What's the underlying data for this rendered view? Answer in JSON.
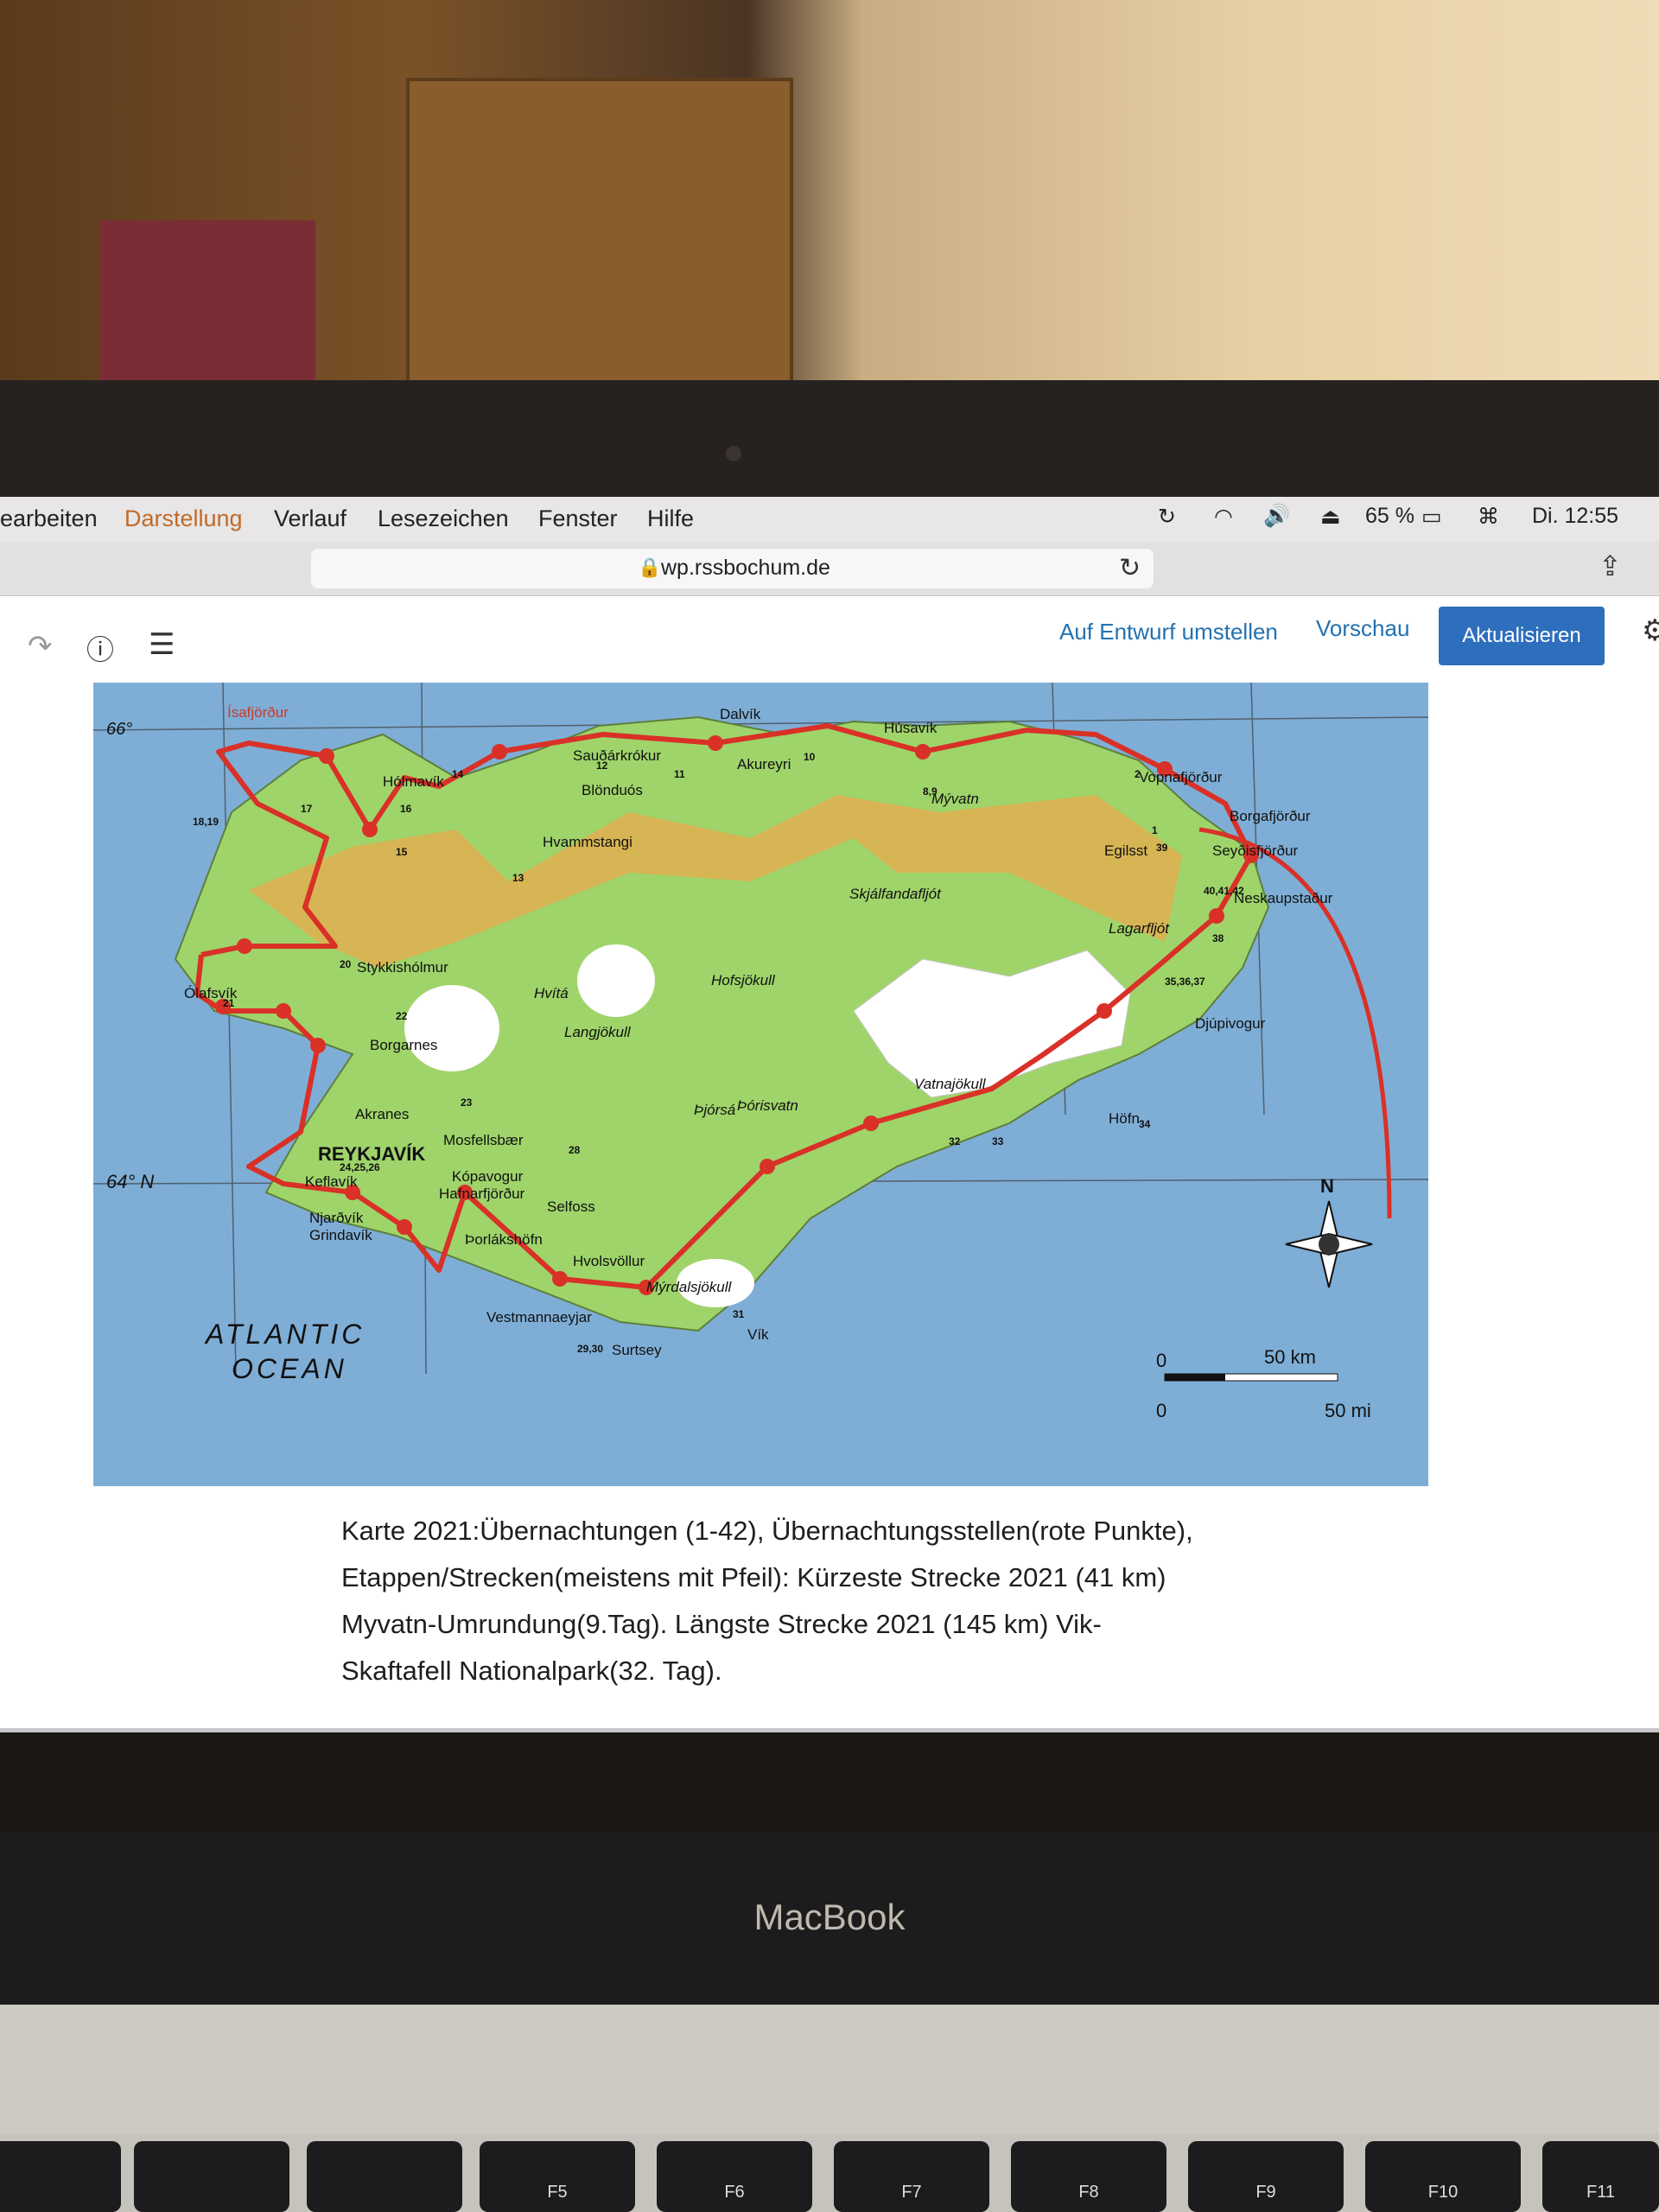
{
  "menubar": {
    "items": [
      "earbeiten",
      "Darstellung",
      "Verlauf",
      "Lesezeichen",
      "Fenster",
      "Hilfe"
    ],
    "battery": "65 %",
    "clock": "Di. 12:55"
  },
  "browser": {
    "url": "wp.rssbochum.de"
  },
  "editor": {
    "switch_to_draft": "Auf Entwurf umstellen",
    "preview": "Vorschau",
    "update": "Aktualisieren"
  },
  "map": {
    "lat_66": "66°",
    "lat_64": "64° N",
    "ocean": [
      "ATLANTIC",
      "OCEAN"
    ],
    "north": "N",
    "scale_km": "50 km",
    "scale_mi": "50 mi",
    "scale_zero": "0",
    "places": [
      "Ísafjörður",
      "Hólmavík",
      "Sauðárkrókur",
      "Blönduós",
      "Dalvík",
      "Akureyri",
      "Húsavík",
      "Mývatn",
      "Vopnafjörður",
      "Borgafjörður",
      "Egilsst",
      "Seyðisfjörður",
      "Neskaupstaður",
      "Lagarfljót",
      "Djúpivogur",
      "Hvammstangi",
      "Stykkishólmur",
      "Ólafsvík",
      "Borgarnes",
      "Akranes",
      "REYKJAVÍK",
      "Mosfellsbær",
      "Kópavogur",
      "Hafnarfjörður",
      "Keflavík",
      "Njarðvík",
      "Grindavík",
      "Þorlákshöfn",
      "Selfoss",
      "Hvolsvöllur",
      "Vestmannaeyjar",
      "Surtsey",
      "Mýrdalsjökull",
      "Vík",
      "Hofsjökull",
      "Langjökull",
      "Hvítá",
      "Þjórsá",
      "Þórisvatn",
      "Vatnajökull",
      "Skjálfandafljót",
      "Höfn"
    ],
    "stop_numbers": [
      "18,19",
      "17",
      "16",
      "15",
      "14",
      "13",
      "12",
      "11",
      "10",
      "8,9",
      "2",
      "1",
      "39",
      "40,41,42",
      "38",
      "35,36,37",
      "34",
      "33",
      "32",
      "31",
      "29,30",
      "28",
      "24,25,26",
      "23",
      "22",
      "21",
      "20"
    ]
  },
  "caption": "Karte 2021:Übernachtungen (1-42), Übernachtungsstellen(rote Punkte), Etappen/Strecken(meistens mit Pfeil): Kürzeste Strecke 2021 (41 km) Myvatn-Umrundung(9.Tag). Längste Strecke 2021 (145 km) Vik-Skaftafell Nationalpark(32. Tag).",
  "laptop": {
    "brand": "MacBook"
  },
  "fn_keys": [
    "F5",
    "F6",
    "F7",
    "F8",
    "F9",
    "F10",
    "F11"
  ],
  "colors": {
    "route": "#d93127",
    "sea": "#7eaed6",
    "land": "#9fd46a",
    "wp_blue": "#2271b1"
  }
}
